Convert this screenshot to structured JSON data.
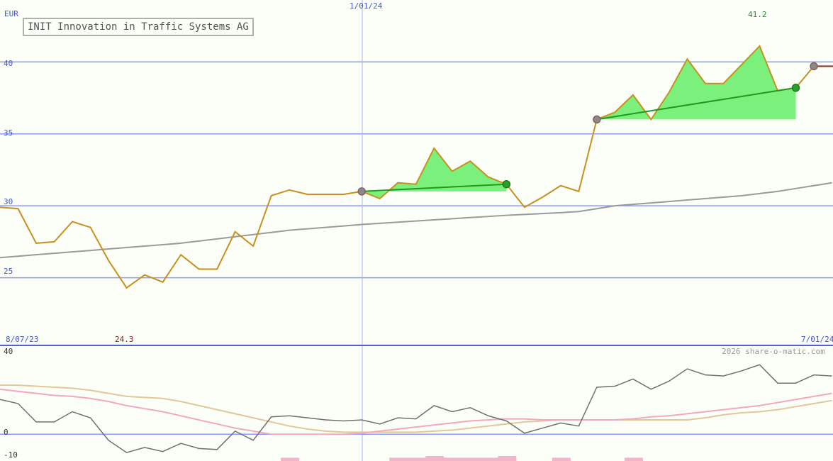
{
  "title": "INIT Innovation in Traffic Systems AG",
  "currency": "EUR",
  "top_date_label": "1/01/24",
  "start_date_label": "8/07/23",
  "end_date_label": "7/01/24",
  "max_label": "41.2",
  "min_label": "24.3",
  "watermark": "2026 share-o-matic.com",
  "price_y_ticks": [
    "40",
    "35",
    "30",
    "25"
  ],
  "osc_y_ticks": [
    "40",
    "0",
    "-10"
  ],
  "colors": {
    "price": "#c8901e",
    "ma_long": "#9a9a9a",
    "fill_up": "#7cf07c",
    "trend": "#1f9a1f",
    "grid": "#8c9cf0",
    "osc_main": "#707070",
    "osc_pink": "#f4a8c0",
    "osc_tan": "#e0c898",
    "hist": "#f4b4cc",
    "end_line": "#9a2a2a"
  },
  "chart_data": {
    "type": "line",
    "title": "INIT Innovation in Traffic Systems AG",
    "ylabel": "EUR",
    "ylim": [
      20.3,
      44.3
    ],
    "x_start": "8/07/23",
    "x_end": "7/01/24",
    "series": [
      {
        "values": [
          29.9,
          29.8,
          27.4,
          27.5,
          28.9,
          28.5,
          26.2,
          24.3,
          25.2,
          24.7,
          26.6,
          25.6,
          25.6,
          28.2,
          27.2,
          30.7,
          31.1,
          30.8,
          30.8,
          30.8,
          31.0,
          30.5,
          31.6,
          31.5,
          34.0,
          32.4,
          33.1,
          32.0,
          31.5,
          29.9,
          30.6,
          31.4,
          31.0,
          36.0,
          36.5,
          37.7,
          36.0,
          37.9,
          40.2,
          38.5,
          38.5,
          39.8,
          41.1,
          38.0,
          38.2,
          39.7,
          39.7
        ]
      },
      {
        "values": [
          26.4,
          26.5,
          26.6,
          26.7,
          26.8,
          26.9,
          27.0,
          27.1,
          27.2,
          27.3,
          27.4,
          27.55,
          27.7,
          27.85,
          28.0,
          28.15,
          28.3,
          28.4,
          28.5,
          28.6,
          28.7,
          28.78,
          28.86,
          28.94,
          29.02,
          29.1,
          29.18,
          29.26,
          29.34,
          29.4,
          29.46,
          29.52,
          29.6,
          29.8,
          30.0,
          30.1,
          30.2,
          30.3,
          30.4,
          30.5,
          30.6,
          30.7,
          30.85,
          31.0,
          31.2,
          31.4,
          31.6
        ]
      }
    ],
    "trend_segments": [
      {
        "from": [
          20,
          31.0
        ],
        "to": [
          28,
          31.5
        ]
      },
      {
        "from": [
          33,
          36.0
        ],
        "to": [
          44,
          38.2
        ]
      }
    ],
    "markers": [
      {
        "i": 20,
        "v": 31.0,
        "kind": "start"
      },
      {
        "i": 28,
        "v": 31.5,
        "kind": "end"
      },
      {
        "i": 33,
        "v": 36.0,
        "kind": "start"
      },
      {
        "i": 44,
        "v": 38.2,
        "kind": "end"
      },
      {
        "i": 45,
        "v": 39.7,
        "kind": "start"
      }
    ],
    "oscillator": {
      "ylim": [
        -10,
        40
      ],
      "main": [
        17,
        15,
        6,
        6,
        11,
        8,
        -3,
        -9,
        -6.5,
        -8.5,
        -4.5,
        -7,
        -7.5,
        1.5,
        -3,
        8.5,
        9,
        8,
        7,
        6.5,
        7,
        5,
        8,
        7.5,
        14,
        11,
        13,
        9,
        6.5,
        0.5,
        3,
        5.5,
        4,
        23,
        23.5,
        27,
        22,
        26,
        32,
        29,
        28.5,
        31,
        34,
        25,
        25,
        29,
        28.5
      ],
      "pink": [
        22,
        21,
        20,
        19,
        18.5,
        17.5,
        16,
        14,
        12.5,
        11,
        9,
        7,
        5,
        3,
        1.5,
        0,
        0,
        0,
        0,
        0,
        0.5,
        1.5,
        2.5,
        3.5,
        4.5,
        5.5,
        6.5,
        7,
        7.5,
        7.5,
        7,
        7,
        7,
        7,
        7,
        7.5,
        8.5,
        9,
        10,
        11,
        12,
        13,
        14,
        15.5,
        17,
        18.5,
        20
      ],
      "tan": [
        24,
        24,
        23.5,
        23,
        22.5,
        21.5,
        20,
        18.5,
        18,
        17.5,
        16,
        14,
        12,
        10,
        8,
        6,
        4,
        2.5,
        1.5,
        1,
        1,
        1,
        1,
        1,
        1.5,
        2,
        3,
        4,
        5,
        6,
        6.5,
        7,
        7,
        7,
        7,
        7,
        7,
        7,
        7,
        8,
        9.5,
        10.5,
        11,
        12,
        13.5,
        15,
        16.5
      ],
      "histogram": [
        {
          "i": 16,
          "v": 0.8
        },
        {
          "i": 22,
          "v": 0.8
        },
        {
          "i": 23,
          "v": 0.8
        },
        {
          "i": 24,
          "v": 1.2
        },
        {
          "i": 25,
          "v": 0.8
        },
        {
          "i": 26,
          "v": 0.8
        },
        {
          "i": 27,
          "v": 0.8
        },
        {
          "i": 28,
          "v": 1.2
        },
        {
          "i": 31,
          "v": 0.8
        },
        {
          "i": 35,
          "v": 0.8
        }
      ]
    }
  }
}
